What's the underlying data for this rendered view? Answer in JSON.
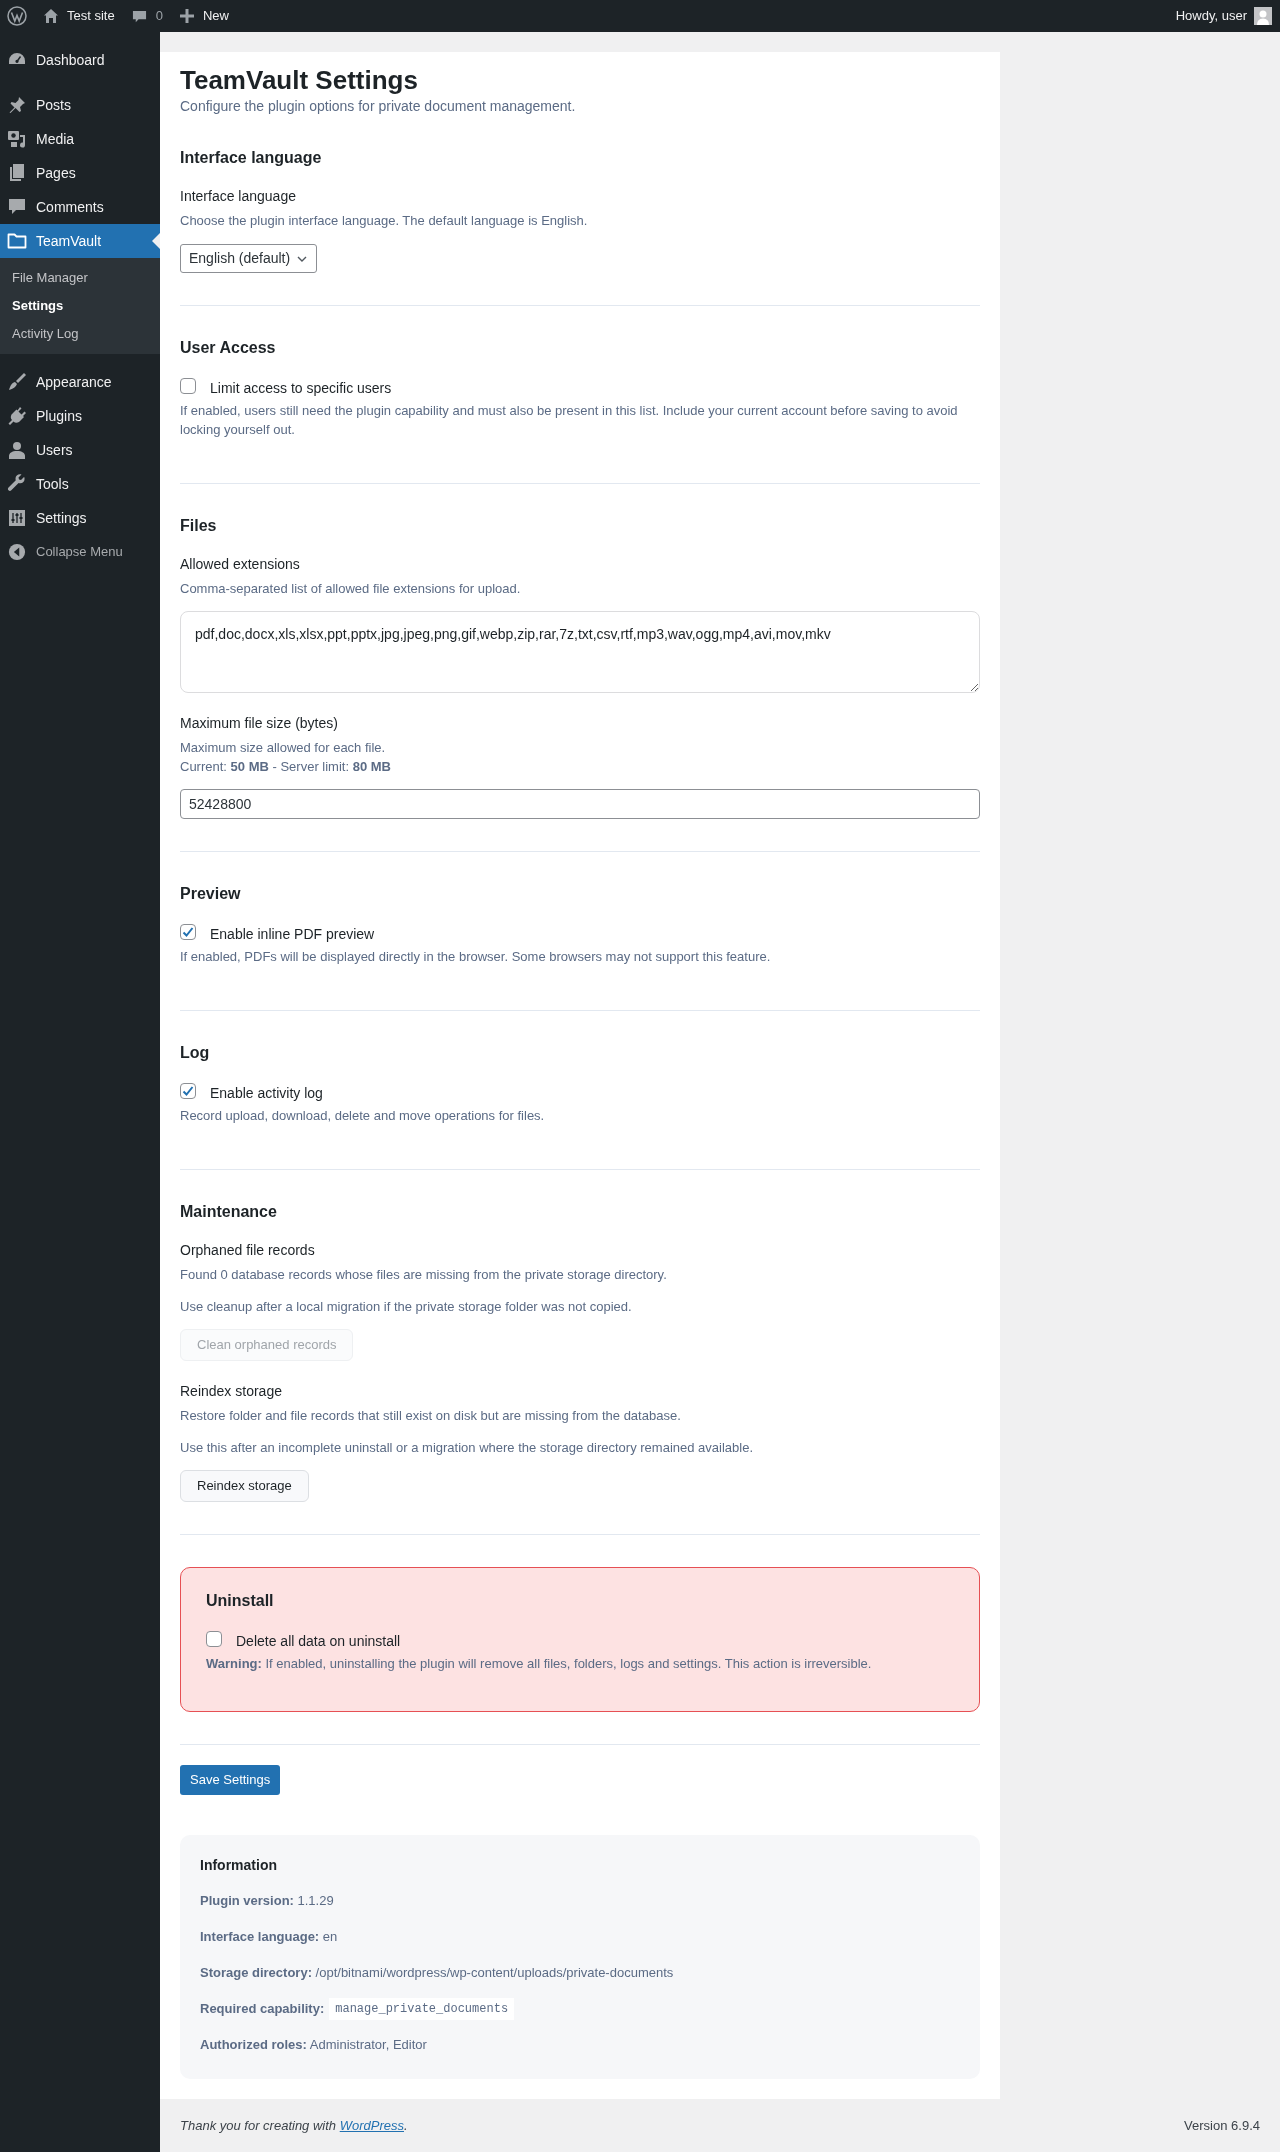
{
  "admin_bar": {
    "site": "Test site",
    "comments": "0",
    "new": "New",
    "greeting": "Howdy, user"
  },
  "sidebar": {
    "groups": [
      [
        {
          "label": "Dashboard",
          "selected": false
        }
      ],
      [
        {
          "label": "Posts",
          "selected": false
        },
        {
          "label": "Media",
          "selected": false
        },
        {
          "label": "Pages",
          "selected": false
        },
        {
          "label": "Comments",
          "selected": false
        },
        {
          "label": "TeamVault",
          "selected": true,
          "children": [
            {
              "label": "File Manager",
              "selected": false
            },
            {
              "label": "Settings",
              "selected": true
            },
            {
              "label": "Activity Log",
              "selected": false
            }
          ]
        }
      ],
      [
        {
          "label": "Appearance",
          "selected": false
        },
        {
          "label": "Plugins",
          "selected": false
        },
        {
          "label": "Users",
          "selected": false
        },
        {
          "label": "Tools",
          "selected": false
        },
        {
          "label": "Settings",
          "selected": false
        }
      ]
    ],
    "collapse": "Collapse Menu"
  },
  "page": {
    "title": "TeamVault Settings",
    "subtitle": "Configure the plugin options for private document management.",
    "sections": [
      {
        "heading": "Interface language",
        "danger": false,
        "items": [
          {
            "kind": "select",
            "label": "Interface language",
            "description": [
              "Choose the plugin interface language. The default language is English."
            ],
            "value": "English (default)"
          }
        ]
      },
      {
        "heading": "User Access",
        "danger": false,
        "items": [
          {
            "kind": "checkbox",
            "label": "Limit access to specific users",
            "checked": false,
            "description": [
              "If enabled, users still need the plugin capability and must also be present in this list. Include your current account before saving to avoid locking yourself out."
            ]
          }
        ]
      },
      {
        "heading": "Files",
        "danger": false,
        "items": [
          {
            "kind": "textarea",
            "label": "Allowed extensions",
            "description": [
              "Comma-separated list of allowed file extensions for upload."
            ],
            "value": "pdf,doc,docx,xls,xlsx,ppt,pptx,jpg,jpeg,png,gif,webp,zip,rar,7z,txt,csv,rtf,mp3,wav,ogg,mp4,avi,mov,mkv"
          },
          {
            "kind": "input",
            "label": "Maximum file size (bytes)",
            "description": [
              "Maximum size allowed for each file.",
              "Current: **50 MB** - Server limit: **80 MB**"
            ],
            "value": "52428800"
          }
        ]
      },
      {
        "heading": "Preview",
        "danger": false,
        "items": [
          {
            "kind": "checkbox",
            "label": "Enable inline PDF preview",
            "checked": true,
            "description": [
              "If enabled, PDFs will be displayed directly in the browser. Some browsers may not support this feature."
            ]
          }
        ]
      },
      {
        "heading": "Log",
        "danger": false,
        "items": [
          {
            "kind": "checkbox",
            "label": "Enable activity log",
            "checked": true,
            "description": [
              "Record upload, download, delete and move operations for files."
            ]
          }
        ]
      },
      {
        "heading": "Maintenance",
        "danger": false,
        "items": [
          {
            "kind": "action",
            "label": "Orphaned file records",
            "description": [
              "Found 0 database records whose files are missing from the private storage directory.",
              "Use cleanup after a local migration if the private storage folder was not copied."
            ],
            "button": {
              "label": "Clean orphaned records",
              "disabled": true
            }
          },
          {
            "kind": "action",
            "label": "Reindex storage",
            "description": [
              "Restore folder and file records that still exist on disk but are missing from the database.",
              "Use this after an incomplete uninstall or a migration where the storage directory remained available."
            ],
            "button": {
              "label": "Reindex storage",
              "disabled": false
            }
          }
        ]
      },
      {
        "heading": "Uninstall",
        "danger": true,
        "items": [
          {
            "kind": "checkbox",
            "label": "Delete all data on uninstall",
            "checked": false,
            "description": [
              "**Warning:** If enabled, uninstalling the plugin will remove all files, folders, logs and settings. This action is irreversible."
            ]
          }
        ]
      }
    ],
    "save_button": "Save Settings",
    "info": {
      "heading": "Information",
      "rows": [
        {
          "kind": "text",
          "text": "**Plugin version:** 1.1.29"
        },
        {
          "kind": "text",
          "text": "**Interface language:** en"
        },
        {
          "kind": "text",
          "text": "**Storage directory:** /opt/bitnami/wordpress/wp-content/uploads/private-documents"
        },
        {
          "kind": "code",
          "label": "Required capability:",
          "code": "manage_private_documents"
        },
        {
          "kind": "text",
          "text": "**Authorized roles:** Administrator, Editor"
        }
      ]
    }
  },
  "footer": {
    "before": "Thank you for creating with ",
    "link": "WordPress",
    "after": ".",
    "version": "Version 6.9.4"
  }
}
